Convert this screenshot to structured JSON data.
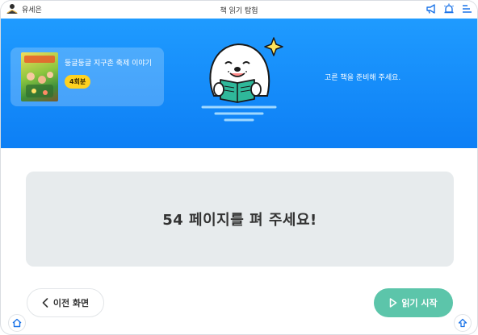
{
  "topbar": {
    "user_name": "유세은",
    "title": "책 읽기 탐험",
    "icons": [
      "reading-user-icon",
      "megaphone-icon",
      "alarm-icon",
      "menu-icon"
    ]
  },
  "hero": {
    "book_title": "둥글둥글 지구촌 축제 이야기",
    "book_badge": "4회분",
    "message": "고른 책을 준비해 주세요."
  },
  "main": {
    "instruction": "54 페이지를 펴 주세요!"
  },
  "buttons": {
    "prev_label": "이전 화면",
    "start_label": "읽기 시작"
  },
  "colors": {
    "hero_blue": "#1f9bff",
    "badge_yellow": "#ffd21f",
    "start_green": "#5cc5aa",
    "card_gray": "#e7ebed"
  }
}
